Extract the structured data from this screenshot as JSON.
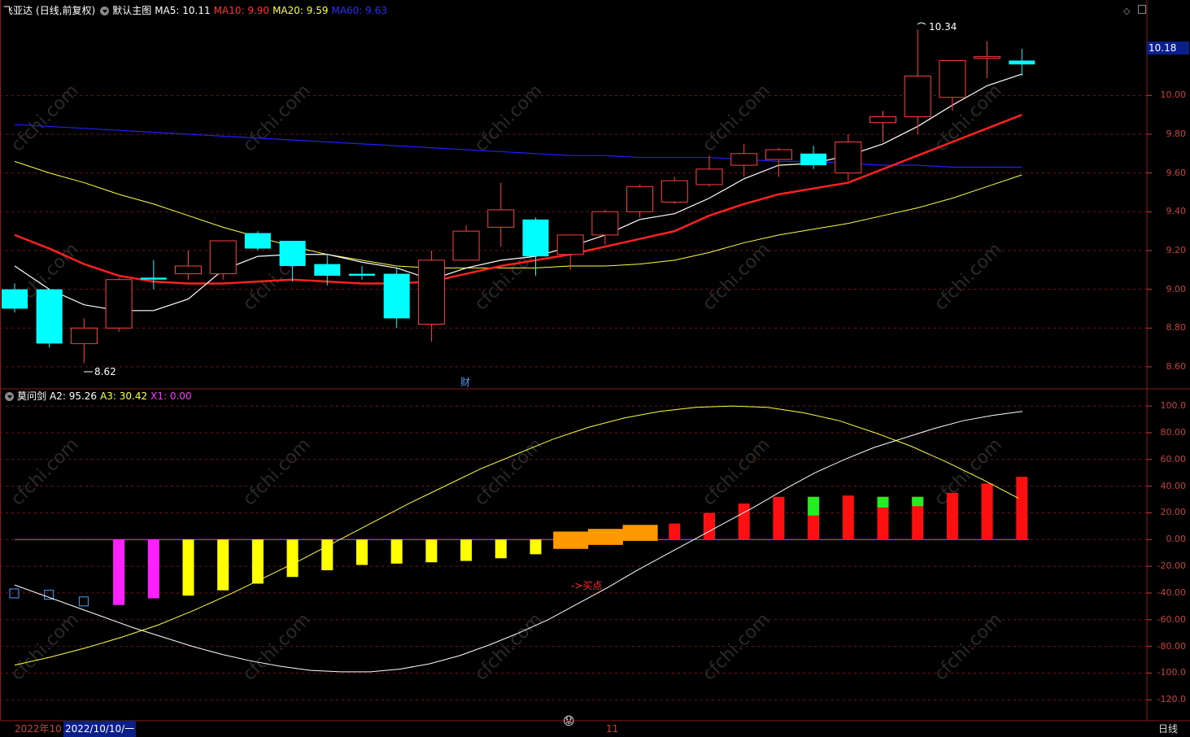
{
  "top_header": {
    "stock_name": "飞亚达",
    "mode": "(日线,前复权)",
    "chart_name": "默认主图",
    "ma5": "MA5: 10.11",
    "ma10": "MA10: 9.90",
    "ma20": "MA20: 9.59",
    "ma60": "MA60: 9.63"
  },
  "lower_header": {
    "indicator_name": "莫问剑",
    "a2": "A2: 95.26",
    "a3": "A3: 30.42",
    "x1": "X1: 0.00"
  },
  "price_axis_ticks": [
    "10.00",
    "9.80",
    "9.60",
    "9.40",
    "9.20",
    "9.00",
    "8.80",
    "8.60"
  ],
  "current_price_tag": "10.18",
  "indicator_axis_ticks": [
    "100.0",
    "80.00",
    "60.00",
    "40.00",
    "20.00",
    "0.00",
    "-20.00",
    "-40.00",
    "-60.00",
    "-80.00",
    "-100.0",
    "-120.0"
  ],
  "annotations": {
    "high_label": "10.34",
    "low_label": "8.62",
    "cai_marker": "财",
    "buy_point": "->买点"
  },
  "bottom_bar": {
    "year_month": "2022年10",
    "date": "2022/10/10/一",
    "month_11": "11",
    "period": "日线"
  },
  "watermark": "cfchi.com",
  "colors": {
    "up": "#ff4040",
    "down": "#00ffff",
    "ma5": "#ffffff",
    "ma10": "#ff2020",
    "ma20": "#ffff40",
    "ma60": "#2020ff",
    "grid": "#7a1010"
  },
  "chart_data": {
    "type": "candlestick",
    "price_range": [
      8.52,
      10.4
    ],
    "candles": [
      {
        "o": 9.0,
        "h": 9.03,
        "l": 8.88,
        "c": 8.9
      },
      {
        "o": 9.0,
        "h": 9.0,
        "l": 8.7,
        "c": 8.72
      },
      {
        "o": 8.72,
        "h": 8.85,
        "l": 8.62,
        "c": 8.8
      },
      {
        "o": 8.8,
        "h": 9.06,
        "l": 8.78,
        "c": 9.05
      },
      {
        "o": 9.06,
        "h": 9.15,
        "l": 9.0,
        "c": 9.05
      },
      {
        "o": 9.08,
        "h": 9.2,
        "l": 9.05,
        "c": 9.12
      },
      {
        "o": 9.08,
        "h": 9.25,
        "l": 9.05,
        "c": 9.25
      },
      {
        "o": 9.29,
        "h": 9.3,
        "l": 9.2,
        "c": 9.21
      },
      {
        "o": 9.25,
        "h": 9.25,
        "l": 9.04,
        "c": 9.12
      },
      {
        "o": 9.13,
        "h": 9.18,
        "l": 9.02,
        "c": 9.07
      },
      {
        "o": 9.08,
        "h": 9.12,
        "l": 9.05,
        "c": 9.07
      },
      {
        "o": 9.08,
        "h": 9.11,
        "l": 8.8,
        "c": 8.85
      },
      {
        "o": 8.82,
        "h": 9.2,
        "l": 8.73,
        "c": 9.15
      },
      {
        "o": 9.15,
        "h": 9.33,
        "l": 9.15,
        "c": 9.3
      },
      {
        "o": 9.32,
        "h": 9.55,
        "l": 9.22,
        "c": 9.41
      },
      {
        "o": 9.36,
        "h": 9.37,
        "l": 9.07,
        "c": 9.17
      },
      {
        "o": 9.18,
        "h": 9.28,
        "l": 9.1,
        "c": 9.28
      },
      {
        "o": 9.28,
        "h": 9.41,
        "l": 9.23,
        "c": 9.4
      },
      {
        "o": 9.4,
        "h": 9.54,
        "l": 9.37,
        "c": 9.53
      },
      {
        "o": 9.45,
        "h": 9.58,
        "l": 9.44,
        "c": 9.56
      },
      {
        "o": 9.54,
        "h": 9.69,
        "l": 9.53,
        "c": 9.62
      },
      {
        "o": 9.64,
        "h": 9.75,
        "l": 9.58,
        "c": 9.7
      },
      {
        "o": 9.67,
        "h": 9.73,
        "l": 9.58,
        "c": 9.72
      },
      {
        "o": 9.7,
        "h": 9.74,
        "l": 9.62,
        "c": 9.64
      },
      {
        "o": 9.6,
        "h": 9.8,
        "l": 9.56,
        "c": 9.76
      },
      {
        "o": 9.86,
        "h": 9.92,
        "l": 9.76,
        "c": 9.89
      },
      {
        "o": 9.89,
        "h": 10.34,
        "l": 9.8,
        "c": 10.1
      },
      {
        "o": 9.99,
        "h": 10.16,
        "l": 9.92,
        "c": 10.18
      },
      {
        "o": 10.2,
        "h": 10.28,
        "l": 10.09,
        "c": 10.2
      },
      {
        "o": 10.18,
        "h": 10.24,
        "l": 10.1,
        "c": 10.16
      }
    ],
    "ma5": [
      9.12,
      9.0,
      8.92,
      8.89,
      8.89,
      8.95,
      9.1,
      9.17,
      9.18,
      9.18,
      9.14,
      9.11,
      9.05,
      9.11,
      9.15,
      9.17,
      9.22,
      9.28,
      9.36,
      9.39,
      9.47,
      9.57,
      9.64,
      9.65,
      9.69,
      9.75,
      9.84,
      9.95,
      10.05,
      10.11
    ],
    "ma10": [
      9.28,
      9.21,
      9.13,
      9.07,
      9.04,
      9.03,
      9.03,
      9.04,
      9.05,
      9.04,
      9.03,
      9.03,
      9.04,
      9.08,
      9.12,
      9.15,
      9.18,
      9.22,
      9.26,
      9.3,
      9.38,
      9.44,
      9.49,
      9.52,
      9.55,
      9.62,
      9.69,
      9.76,
      9.83,
      9.9
    ],
    "ma20": [
      9.66,
      9.6,
      9.55,
      9.49,
      9.44,
      9.38,
      9.32,
      9.27,
      9.22,
      9.18,
      9.15,
      9.12,
      9.11,
      9.11,
      9.11,
      9.11,
      9.12,
      9.12,
      9.13,
      9.15,
      9.19,
      9.24,
      9.28,
      9.31,
      9.34,
      9.38,
      9.42,
      9.47,
      9.53,
      9.59
    ],
    "ma60": [
      9.85,
      9.84,
      9.83,
      9.82,
      9.81,
      9.8,
      9.79,
      9.78,
      9.77,
      9.76,
      9.75,
      9.74,
      9.73,
      9.72,
      9.71,
      9.7,
      9.69,
      9.69,
      9.68,
      9.68,
      9.68,
      9.67,
      9.66,
      9.66,
      9.65,
      9.64,
      9.64,
      9.63,
      9.63,
      9.63
    ],
    "indicator_range": [
      -132,
      108
    ],
    "bars": [
      {
        "v": null,
        "box": -40
      },
      {
        "v": null,
        "box": -41
      },
      {
        "v": null,
        "box": -46
      },
      {
        "v": -49,
        "color": "#ff20ff"
      },
      {
        "v": -44,
        "color": "#ff20ff"
      },
      {
        "v": -42,
        "color": "#ffff00"
      },
      {
        "v": -38,
        "color": "#ffff00"
      },
      {
        "v": -33,
        "color": "#ffff00"
      },
      {
        "v": -28,
        "color": "#ffff00"
      },
      {
        "v": -23,
        "color": "#ffff00"
      },
      {
        "v": -19,
        "color": "#ffff00"
      },
      {
        "v": -18,
        "color": "#ffff00"
      },
      {
        "v": -17,
        "color": "#ffff00"
      },
      {
        "v": -16,
        "color": "#ffff00"
      },
      {
        "v": -14,
        "color": "#ffff00"
      },
      {
        "v": -11,
        "color": "#ffff00"
      },
      {
        "v": 6,
        "color": "#ff9900",
        "wide": true,
        "low": -7
      },
      {
        "v": 8,
        "color": "#ff9900",
        "wide": true,
        "low": -4
      },
      {
        "v": 11,
        "color": "#ff9900",
        "wide": true,
        "low": -1
      },
      {
        "v": 12,
        "color": "#ff1010"
      },
      {
        "v": 20,
        "color": "#ff1010"
      },
      {
        "v": 27,
        "color": "#ff1010"
      },
      {
        "v": 32,
        "color": "#ff1010"
      },
      {
        "v": 32,
        "color": "#ff1010",
        "green": [
          18,
          32
        ]
      },
      {
        "v": 33,
        "color": "#ff1010"
      },
      {
        "v": 32,
        "color": "#ff1010",
        "green": [
          24,
          32
        ]
      },
      {
        "v": 32,
        "color": "#ff1010",
        "green": [
          25,
          32
        ]
      },
      {
        "v": 35,
        "color": "#ff1010"
      },
      {
        "v": 42,
        "color": "#ff1010"
      },
      {
        "v": 47,
        "color": "#ff1010"
      }
    ],
    "a2_line": [
      -34,
      -42,
      -50,
      -58,
      -66,
      -73,
      -80,
      -86,
      -91,
      -95,
      -98,
      -99,
      -99,
      -97,
      -93,
      -87,
      -79,
      -70,
      -60,
      -48,
      -36,
      -23,
      -11,
      1,
      13,
      25,
      38,
      50,
      60,
      69,
      76,
      83,
      89,
      93,
      96
    ],
    "a3_line": [
      -94,
      -88,
      -81,
      -73,
      -64,
      -53,
      -41,
      -28,
      -15,
      -1,
      13,
      27,
      40,
      53,
      64,
      75,
      84,
      91,
      96,
      99,
      100,
      99,
      95,
      89,
      80,
      70,
      58,
      45,
      31
    ],
    "ma_sample_x": [
      0,
      1,
      2,
      3,
      4,
      5,
      6,
      7,
      8,
      9,
      10,
      11,
      12,
      13,
      14,
      15,
      16,
      17,
      18,
      19,
      20,
      21,
      22,
      23,
      24,
      25,
      26,
      27,
      28,
      29
    ]
  }
}
